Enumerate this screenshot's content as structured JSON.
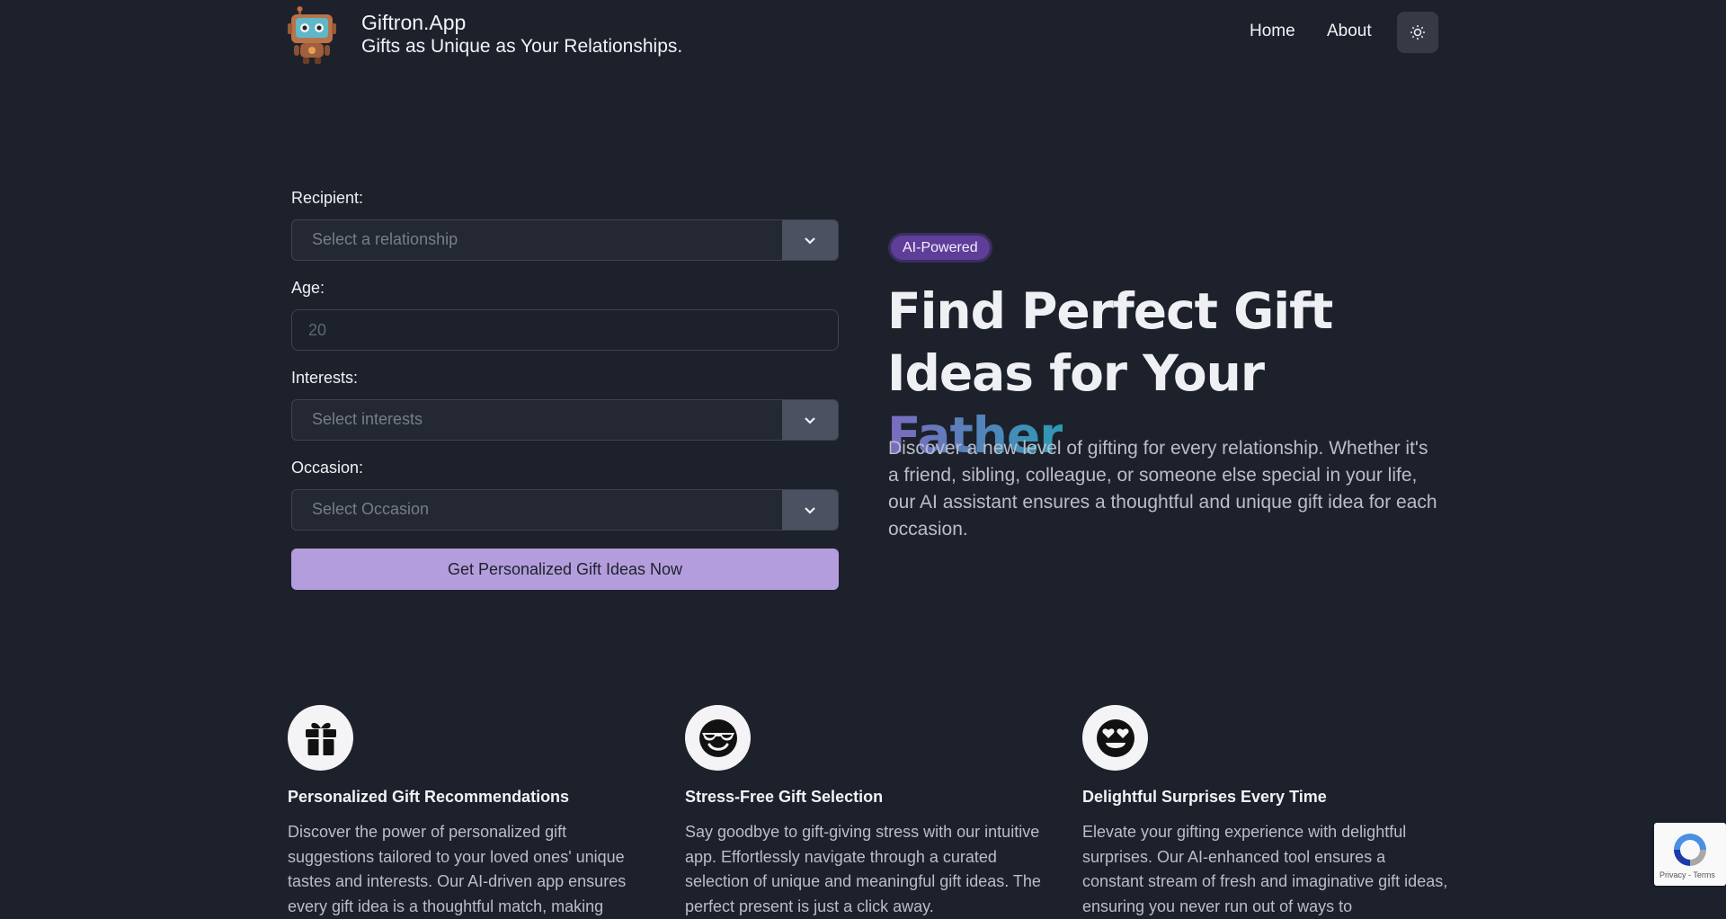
{
  "header": {
    "brand_title": "Giftron.App",
    "brand_tagline": "Gifts as Unique as Your Relationships.",
    "logo_icon": "robot-logo-icon",
    "nav": [
      {
        "label": "Home"
      },
      {
        "label": "About"
      }
    ],
    "theme_toggle_icon": "sun-icon"
  },
  "form": {
    "recipient_label": "Recipient:",
    "recipient_placeholder": "Select a relationship",
    "age_label": "Age:",
    "age_placeholder": "20",
    "interests_label": "Interests:",
    "interests_placeholder": "Select interests",
    "occasion_label": "Occasion:",
    "occasion_placeholder": "Select Occasion",
    "submit_label": "Get Personalized Gift Ideas Now"
  },
  "hero": {
    "badge": "AI-Powered",
    "title_prefix": "Find Perfect Gift Ideas for Your ",
    "title_highlight": "Father",
    "description": "Discover a new level of gifting for every relationship. Whether it's a friend, sibling, colleague, or someone else special in your life, our AI assistant ensures a thoughtful and unique gift idea for each occasion."
  },
  "features": [
    {
      "icon": "gift-icon",
      "title": "Personalized Gift Recommendations",
      "description": "Discover the power of personalized gift suggestions tailored to your loved ones' unique tastes and interests. Our AI-driven app ensures every gift idea is a thoughtful match, making"
    },
    {
      "icon": "sunglasses-smile-icon",
      "title": "Stress-Free Gift Selection",
      "description": "Say goodbye to gift-giving stress with our intuitive app. Effortlessly navigate through a curated selection of unique and meaningful gift ideas. The perfect present is just a click away."
    },
    {
      "icon": "heart-eyes-icon",
      "title": "Delightful Surprises Every Time",
      "description": "Elevate your gifting experience with delightful surprises. Our AI-enhanced tool ensures a constant stream of fresh and imaginative gift ideas, ensuring you never run out of ways to"
    }
  ],
  "recaptcha": {
    "links": "Privacy - Terms"
  },
  "colors": {
    "background": "#1d212b",
    "accent": "#b39ddc",
    "badge": "#5f3e9a"
  }
}
